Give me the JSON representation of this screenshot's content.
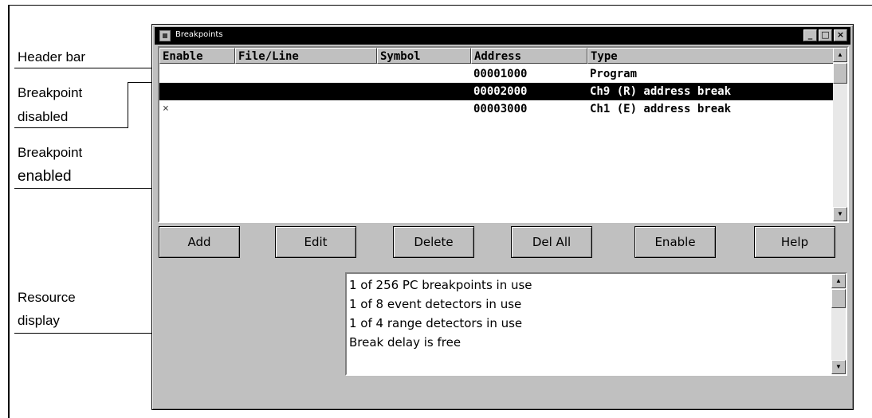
{
  "annotations": {
    "header_bar": "Header bar",
    "breakpoint_disabled_1": "Breakpoint",
    "breakpoint_disabled_2": "disabled",
    "breakpoint_enabled_1": "Breakpoint",
    "breakpoint_enabled_2": "enabled",
    "resource_display_1": "Resource",
    "resource_display_2": "display"
  },
  "window": {
    "title": "Breakpoints",
    "controls": {
      "minimize": "_",
      "maximize": "□",
      "close": "×"
    }
  },
  "table": {
    "columns": [
      "Enable",
      "File/Line",
      "Symbol",
      "Address",
      "Type"
    ],
    "rows": [
      {
        "enable": "",
        "file_line": "",
        "symbol": "",
        "address": "00001000",
        "type": "Program",
        "selected": false
      },
      {
        "enable": "",
        "file_line": "",
        "symbol": "",
        "address": "00002000",
        "type": "Ch9 (R) address break",
        "selected": true
      },
      {
        "enable": "×",
        "file_line": "",
        "symbol": "",
        "address": "00003000",
        "type": "Ch1 (E) address break",
        "selected": false
      }
    ]
  },
  "buttons": {
    "add": "Add",
    "edit": "Edit",
    "delete": "Delete",
    "del_all": "Del All",
    "enable": "Enable",
    "help": "Help"
  },
  "resource": {
    "lines": [
      "1 of 256 PC breakpoints in use",
      "1 of 8 event detectors in use",
      "1 of 4 range detectors in use",
      "Break delay is free"
    ]
  }
}
